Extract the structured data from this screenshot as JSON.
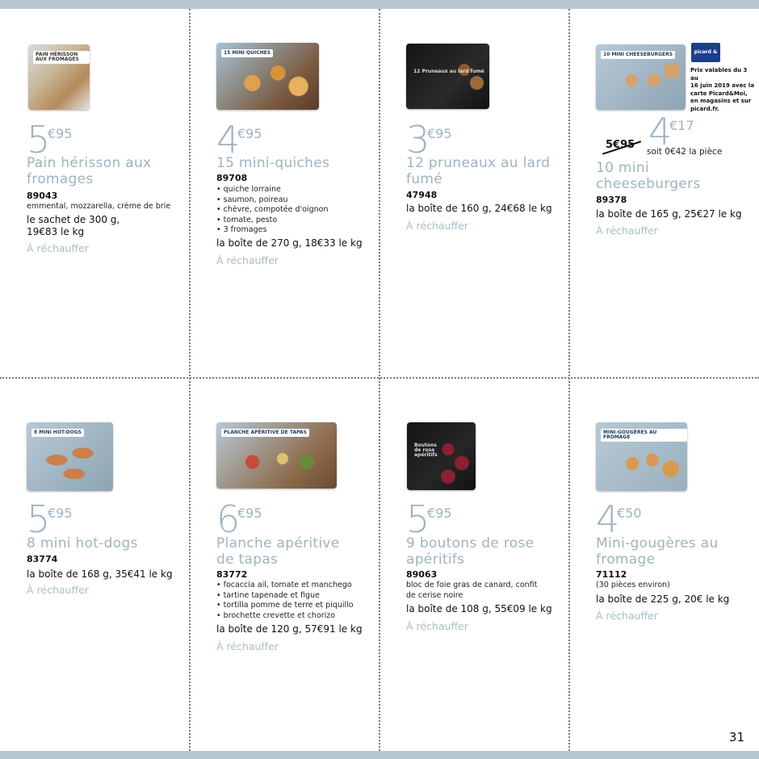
{
  "page_number": "31",
  "colors": {
    "accent": "#9fb3bf",
    "band": "#b7c7cf"
  },
  "products": [
    {
      "id": "p1",
      "price_int": "5",
      "price_cents": "€95",
      "name": "Pain hérisson aux fromages",
      "ref": "89043",
      "desc": "emmental, mozzarella, crème de brie",
      "weight": "le sachet de 300 g,",
      "weight2": "19€83 le kg",
      "reheat": "À réchauffer",
      "pack_label": "PAIN HÉRISSON AUX FROMAGES"
    },
    {
      "id": "p2",
      "price_int": "4",
      "price_cents": "€95",
      "name": "15 mini-quiches",
      "ref": "89708",
      "desc_list": [
        "• quiche lorraine",
        "• saumon, poireau",
        "• chèvre, compotée d'oignon",
        "• tomate, pesto",
        "• 3 fromages"
      ],
      "weight": "la boîte de 270 g, 18€33 le kg",
      "reheat": "À réchauffer",
      "pack_label": "15 MINI QUICHES"
    },
    {
      "id": "p3",
      "price_int": "3",
      "price_cents": "€95",
      "name": "12 pruneaux au lard fumé",
      "ref": "47948",
      "weight": "la boîte de 160 g, 24€68 le kg",
      "reheat": "À réchauffer",
      "pack_label": "12 Pruneaux au lard fumé"
    },
    {
      "id": "p4",
      "price_int": "4",
      "price_cents": "€17",
      "old_price": "5€95",
      "unit_price": "soit 0€42 la pièce",
      "name": "10 mini cheeseburgers",
      "ref": "89378",
      "weight": "la boîte de 165 g, 25€27 le kg",
      "reheat": "À réchauffer",
      "pack_label": "10 MINI CHEESEBURGERS",
      "promo_logo": "picard & moi",
      "promo_text": [
        "Prix valables du 3 au",
        "16 juin 2019 avec la",
        "carte Picard&Moi,",
        "en magasins et sur",
        "picard.fr."
      ]
    },
    {
      "id": "p5",
      "price_int": "5",
      "price_cents": "€95",
      "name": "8 mini hot-dogs",
      "ref": "83774",
      "weight": "la boîte de 168 g, 35€41 le kg",
      "reheat": "À réchauffer",
      "pack_label": "8 MINI HOT-DOGS"
    },
    {
      "id": "p6",
      "price_int": "6",
      "price_cents": "€95",
      "name": "Planche apéritive de tapas",
      "ref": "83772",
      "desc_list": [
        "• focaccia ail, tomate et manchego",
        "• tartine tapenade et figue",
        "• tortilla pomme de terre et piquillo",
        "• brochette crevette et chorizo"
      ],
      "weight": "la boîte de 120 g, 57€91 le kg",
      "reheat": "À réchauffer",
      "pack_label": "PLANCHE APÉRITIVE DE TAPAS"
    },
    {
      "id": "p7",
      "price_int": "5",
      "price_cents": "€95",
      "name": "9 boutons de rose apéritifs",
      "ref": "89063",
      "desc_list": [
        "bloc de foie gras de canard, confit",
        "de cerise noire"
      ],
      "weight": "la boîte de 108 g, 55€09 le kg",
      "reheat": "À réchauffer",
      "pack_label": "Boutons de rose apéritifs"
    },
    {
      "id": "p8",
      "price_int": "4",
      "price_cents": "€50",
      "name": "Mini-gougères au fromage",
      "ref": "71112",
      "desc": "(30 pièces environ)",
      "weight": "la boîte de 225 g, 20€ le kg",
      "reheat": "À réchauffer",
      "pack_label": "MINI-GOUGÈRES AU FROMAGE"
    }
  ]
}
